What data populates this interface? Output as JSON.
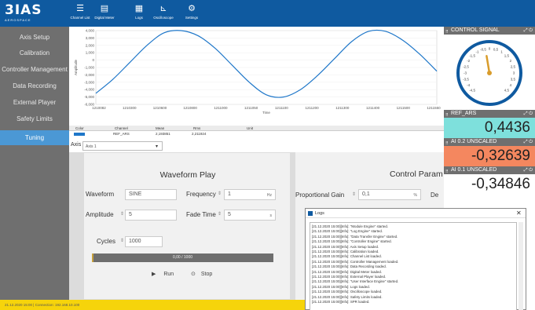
{
  "app": {
    "logo_text": "3IAS",
    "logo_subtext": "AEROSPACE"
  },
  "toolbar": {
    "buttons": [
      {
        "label": "Channel List",
        "icon": "list-icon"
      },
      {
        "label": "Digital Meter",
        "icon": "meter-icon"
      },
      {
        "label": "Logs",
        "icon": "logs-icon"
      },
      {
        "label": "Oscilloscope",
        "icon": "oscilloscope-icon"
      },
      {
        "label": "Settings",
        "icon": "gear-icon"
      }
    ]
  },
  "sidebar": {
    "items": [
      {
        "label": "Axis Setup"
      },
      {
        "label": "Calibration"
      },
      {
        "label": "Controller Management"
      },
      {
        "label": "Data Recording"
      },
      {
        "label": "External Player"
      },
      {
        "label": "Safety Limits"
      },
      {
        "label": "Tuning",
        "active": true
      }
    ]
  },
  "chart_data": {
    "type": "line",
    "xlabel": "Time",
    "ylabel": "Amplitude",
    "yticks": [
      "4,000",
      "3,000",
      "2,000",
      "1,000",
      "0",
      "-1,000",
      "-2,000",
      "-3,000",
      "-4,000",
      "-5,000",
      "-6,000"
    ],
    "ylim": [
      -6000,
      4000
    ],
    "xticks": [
      "1210082",
      "1210300",
      "1210600",
      "1210800",
      "1211000",
      "1211050",
      "1211100",
      "1211200",
      "1211300",
      "1211400",
      "1211500",
      "1211550"
    ],
    "series": [
      {
        "color": "#1f77c9",
        "x_fraction": [
          0,
          0.05,
          0.1,
          0.15,
          0.2,
          0.25,
          0.3,
          0.35,
          0.4,
          0.45,
          0.5,
          0.55,
          0.6,
          0.65,
          0.7,
          0.75,
          0.8,
          0.85,
          0.9,
          0.95,
          1.0
        ],
        "y": [
          -4500,
          -2600,
          -300,
          2000,
          3700,
          4000,
          3300,
          1600,
          -700,
          -3000,
          -4700,
          -5000,
          -4000,
          -2100,
          200,
          2500,
          3900,
          3900,
          2700,
          800,
          -1500
        ]
      }
    ]
  },
  "channel_table": {
    "headers": [
      "Color",
      "Channel",
      "Mean",
      "Rms",
      "Unit"
    ],
    "row": {
      "color": "#1f77c9",
      "channel": "REF_ARS",
      "mean": "2,193851",
      "rms": "2,211924",
      "unit": ""
    }
  },
  "axis_selector": {
    "label": "Axis",
    "value": "Axis 1"
  },
  "waveform_play": {
    "title": "Waveform Play",
    "waveform_label": "Waveform",
    "waveform_value": "SINE",
    "frequency_label": "Frequency",
    "frequency_value": "1",
    "frequency_unit": "Hz",
    "amplitude_label": "Amplitude",
    "amplitude_value": "5",
    "fade_time_label": "Fade Time",
    "fade_time_value": "5",
    "fade_time_unit": "s",
    "cycles_label": "Cycles",
    "cycles_value": "1000",
    "progress_text": "0,00 / 1000",
    "progress_fraction": 0.0,
    "run_label": "Run",
    "stop_label": "Stop"
  },
  "control_params": {
    "title": "Control Param",
    "proportional_gain_label": "Proportional Gain",
    "proportional_gain_value": "0,1",
    "second_label": "De"
  },
  "logs": {
    "title": "Logs",
    "lines": [
      "[21.12.2020 15:00][Info]: \"Module Engine\" started.",
      "[21.12.2020 15:00][Info]: \"Log Engine\" started.",
      "[21.12.2020 15:00][Info]: \"Data Transfer Engine\" started.",
      "[21.12.2020 15:00][Info]: \"Controller Engine\" started.",
      "[21.12.2020 15:00][Info]: Axis Setup loaded.",
      "[21.12.2020 15:00][Info]: Calibration loaded.",
      "[21.12.2020 15:00][Info]: Channel List loaded.",
      "[21.12.2020 15:00][Info]: Controller Management loaded.",
      "[21.12.2020 15:00][Info]: Data Recording loaded.",
      "[21.12.2020 15:00][Info]: Digital Meter loaded.",
      "[21.12.2020 15:00][Info]: External Player loaded.",
      "[21.12.2020 15:00][Info]: \"User Interface Engine\" started.",
      "[21.12.2020 15:00][Info]: Logs loaded.",
      "[21.12.2020 15:00][Info]: Oscilloscope loaded.",
      "[21.12.2020 15:00][Info]: Safety Limits loaded.",
      "[21.12.2020 15:00][Info]: SPR loaded."
    ]
  },
  "widgets": {
    "control_signal": {
      "title": "CONTROL SIGNAL",
      "gauge_labels": [
        "-4,5",
        "-4",
        "-3,5",
        "-3",
        "-2,5",
        "-2",
        "-1,5",
        "-1",
        "-0,5",
        "0",
        "0,5",
        "1",
        "1,5",
        "2",
        "2,5",
        "3",
        "3,5",
        "4",
        "4,5"
      ],
      "gauge_min": -5,
      "gauge_max": 5,
      "gauge_value": -0.35
    },
    "ref_ars": {
      "title": "REF_ARS",
      "value": "0,4436",
      "bg": "#7ee0dc"
    },
    "ai02": {
      "title": "AI 0.2  UNSCALED",
      "value": "-0,32639",
      "bg": "#f4875f"
    },
    "ai01": {
      "title": "AI 0.1  UNSCALED",
      "value": "-0,34846",
      "bg": "#ffffff"
    }
  },
  "status_bar": {
    "text": "21.12.2020 15:00 | Connection: 192.168.10.100"
  }
}
